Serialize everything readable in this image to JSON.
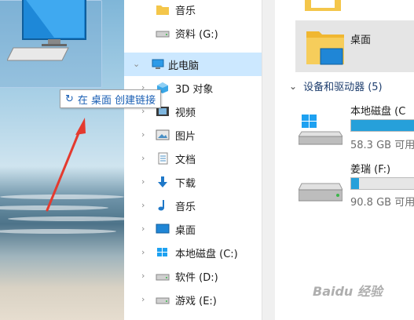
{
  "tooltip": {
    "arrow": "↻",
    "text": "在 桌面 创建链接"
  },
  "nav_items": [
    {
      "id": "music-top",
      "label": "音乐"
    },
    {
      "id": "drive-g",
      "label": "资料 (G:)"
    },
    {
      "id": "this-pc",
      "label": "此电脑"
    },
    {
      "id": "3d-objects",
      "label": "3D 对象"
    },
    {
      "id": "videos",
      "label": "视频"
    },
    {
      "id": "pictures",
      "label": "图片"
    },
    {
      "id": "documents",
      "label": "文档"
    },
    {
      "id": "downloads",
      "label": "下载"
    },
    {
      "id": "music",
      "label": "音乐"
    },
    {
      "id": "desktop",
      "label": "桌面"
    },
    {
      "id": "drive-c",
      "label": "本地磁盘 (C:)"
    },
    {
      "id": "drive-d",
      "label": "软件 (D:)"
    },
    {
      "id": "drive-e",
      "label": "游戏 (E:)"
    }
  ],
  "content": {
    "desktop_tile_label": "桌面",
    "group_header": "设备和驱动器 (5)",
    "drives": [
      {
        "name": "本地磁盘 (C",
        "free": "58.3 GB 可用",
        "used_fraction": 0.85
      },
      {
        "name": "姜瑞 (F:)",
        "free": "90.8 GB 可用",
        "used_fraction": 0.1
      }
    ]
  },
  "watermark": "Baidu 经验",
  "colors": {
    "selection": "#cce8ff",
    "drive_bar": "#26a0da",
    "link_text": "#1a5fb4"
  }
}
